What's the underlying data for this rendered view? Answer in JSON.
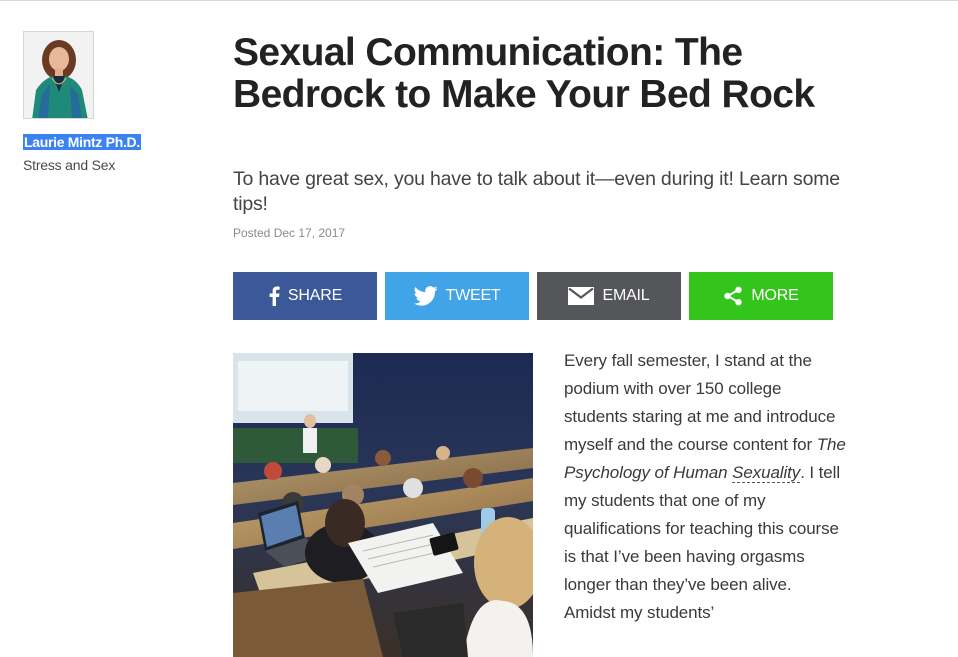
{
  "author": {
    "name": "Laurie Mintz Ph.D.",
    "blog": "Stress and Sex"
  },
  "article": {
    "title": "Sexual Communication: The Bedrock to Make Your Bed Rock",
    "subtitle": "To have great sex, you have to talk about it—even during it! Learn some tips!",
    "posted": "Posted Dec 17, 2017",
    "body": {
      "part1": "Every fall semester, I stand at the podium with over 150 college students staring at me and introduce myself and the course content for ",
      "course_title_start": "The Psychology of Human ",
      "course_title_end": "Sexuality",
      "part2": ". I tell my students that one of my qualifications for teaching this course is that I’ve been having orgasms longer than they’ve been alive. Amidst my students’"
    }
  },
  "share": {
    "facebook": {
      "label": "SHARE",
      "icon": "facebook-icon",
      "color": "#3b5998"
    },
    "twitter": {
      "label": "TWEET",
      "icon": "twitter-bird-icon",
      "color": "#41a4e8"
    },
    "email": {
      "label": "EMAIL",
      "icon": "envelope-icon",
      "color": "#555659"
    },
    "more": {
      "label": "MORE",
      "icon": "share-nodes-icon",
      "color": "#33c51b"
    }
  },
  "colors": {
    "selection_highlight": "#3a83f0",
    "title": "#222222"
  }
}
